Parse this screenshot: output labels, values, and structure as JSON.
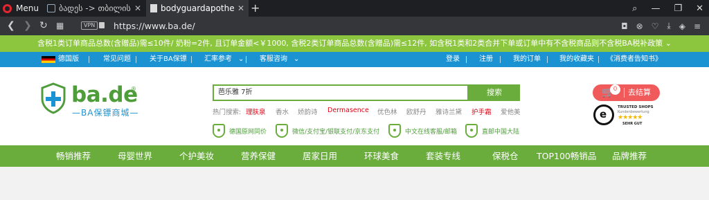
{
  "browser": {
    "menu_label": "Menu",
    "tabs": [
      {
        "label": "ბადეს -> თბილისის",
        "icon": "tab-favicon"
      },
      {
        "label": "bodyguardapotheke",
        "icon": "document-icon"
      }
    ],
    "url": "https://www.ba.de/",
    "vpn_label": "VPN"
  },
  "notice": {
    "text": "含税1类订单商品总数(含赠品)需≤10件/ 奶粉=2件, 且订单金额<￥1000, 含税2类订单商品总数(含赠品)需≤12件, 如含税1类和2类合并下单或订单中有不含税商品则不含税BA税补政策"
  },
  "topnav": {
    "left": [
      "德国版",
      "常见问题",
      "关于BA保镖",
      "汇率参考",
      "客服咨询"
    ],
    "right": [
      "登录",
      "注册",
      "我的订单",
      "我的收藏夹",
      "《消费者告知书》"
    ]
  },
  "logo": {
    "name": "ba.de",
    "reg": "®",
    "subtitle": "—BA保镖商城—"
  },
  "search": {
    "value": "芭乐雅 7折",
    "button": "搜索",
    "hot_label": "热门搜索:",
    "hot_terms": [
      {
        "label": "理肤泉",
        "color": "#e60012"
      },
      {
        "label": "香水",
        "color": "#888888"
      },
      {
        "label": "娇韵诗",
        "color": "#888888"
      },
      {
        "label": "Dermasence",
        "color": "#e60012"
      },
      {
        "label": "优色林",
        "color": "#888888"
      },
      {
        "label": "欧舒丹",
        "color": "#888888"
      },
      {
        "label": "雅诗兰黛",
        "color": "#888888"
      },
      {
        "label": "护手霜",
        "color": "#e60012"
      },
      {
        "label": "爱他美",
        "color": "#888888"
      }
    ]
  },
  "features": [
    {
      "label": "德国原网同价",
      "icon": "plus-shield-icon"
    },
    {
      "label": "微信/支付宝/银联支付/京东支付",
      "icon": "check-shield-icon"
    },
    {
      "label": "中文在线客服/邮箱",
      "icon": "user-shield-icon"
    },
    {
      "label": "直邮中国大陆",
      "icon": "plane-shield-icon"
    }
  ],
  "cart": {
    "count": "0",
    "label": "去结算"
  },
  "trusted": {
    "logo_letter": "e",
    "line1": "TRUSTED SHOPS",
    "line2": "Kundenbewertung",
    "stars": "★★★★★",
    "line3": "SEHR GUT"
  },
  "mainnav": [
    "畅销推荐",
    "母婴世界",
    "个护美妆",
    "营养保健",
    "居家日用",
    "环球美食",
    "套装专线",
    "保税仓",
    "TOP100畅销品",
    "品牌推荐"
  ],
  "colors": {
    "green": "#6aad3c",
    "blue": "#1b93d2",
    "red": "#f05a5b",
    "notice_green": "#8cc63f"
  }
}
